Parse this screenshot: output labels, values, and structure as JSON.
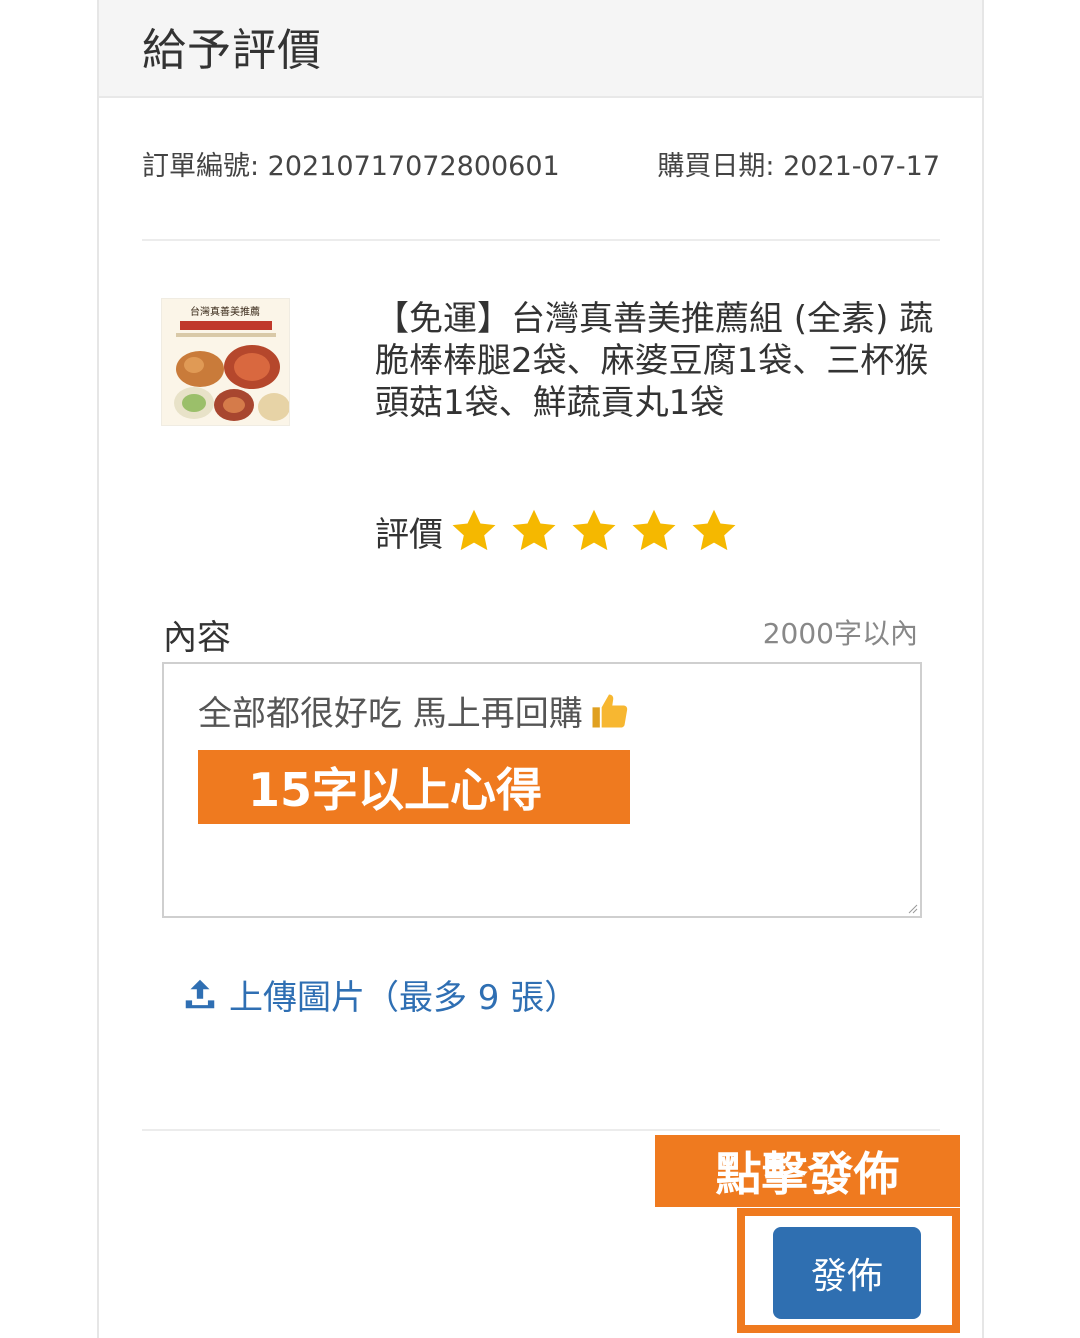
{
  "header": {
    "title": "給予評價"
  },
  "order": {
    "number_label": "訂單編號: 20210717072800601",
    "date_label": "購買日期: 2021-07-17"
  },
  "product": {
    "name": "【免運】台灣真善美推薦組 (全素) 蔬脆棒棒腿2袋、麻婆豆腐1袋、三杯猴頭菇1袋、鮮蔬貢丸1袋",
    "thumbnail_title": "台灣真善美推薦"
  },
  "rating": {
    "label": "評價",
    "stars": 5,
    "max_stars": 5,
    "star_color": "#f5b800"
  },
  "content": {
    "label": "內容",
    "limit": "2000字以內",
    "value": "全部都很好吃 馬上再回購"
  },
  "upload": {
    "label": "上傳圖片（最多 9 張）"
  },
  "annotations": {
    "content_hint": "15字以上心得",
    "publish_hint": "點擊發佈",
    "color": "#ef7a1f"
  },
  "actions": {
    "publish_label": "發佈"
  },
  "colors": {
    "primary": "#2f6fb1",
    "link": "#2f6fb3"
  }
}
